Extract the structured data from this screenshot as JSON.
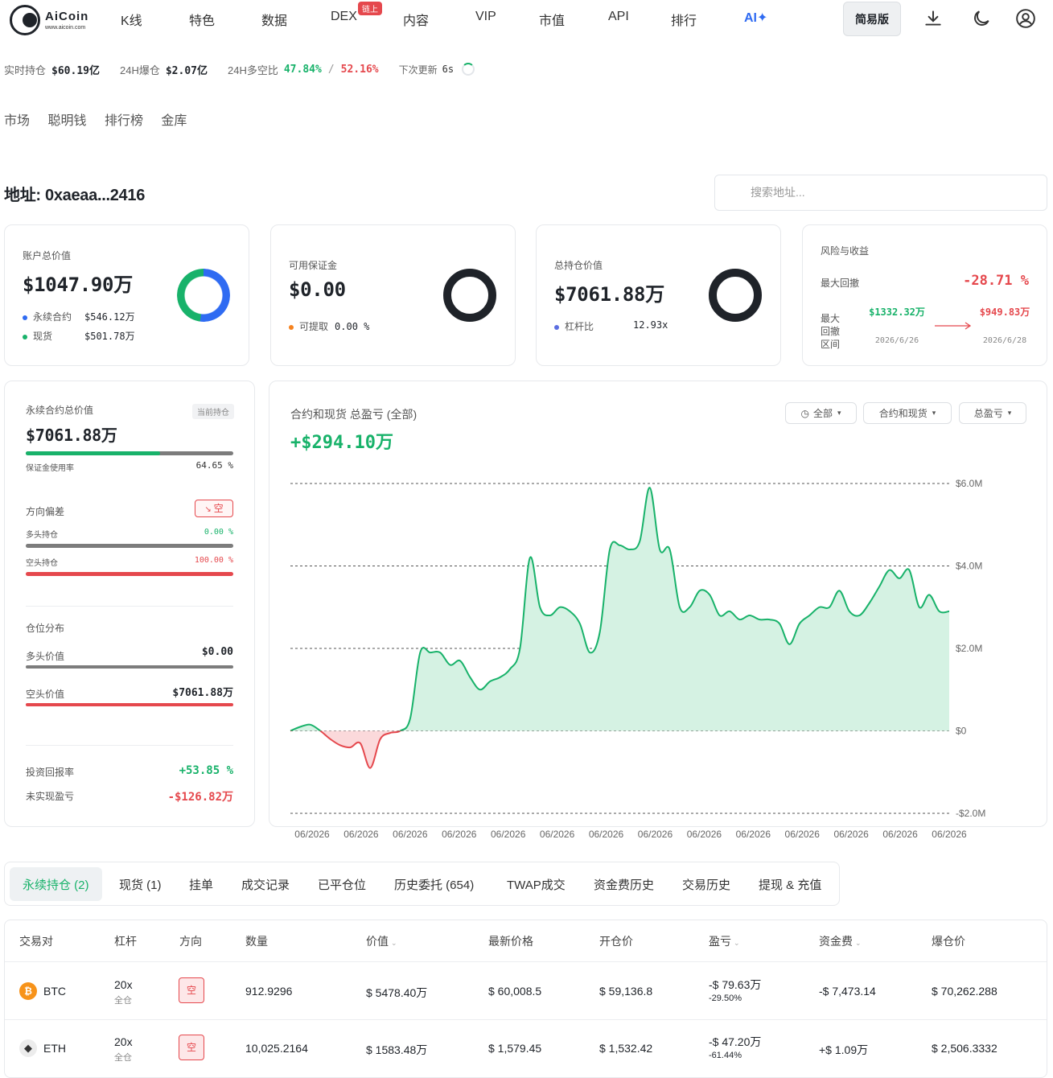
{
  "nav": {
    "logo_name": "AiCoin",
    "logo_sub": "www.aicoin.com",
    "items": [
      "K线",
      "特色",
      "数据",
      "DEX",
      "内容",
      "VIP",
      "市值",
      "API",
      "排行",
      "AI✦"
    ],
    "dex_badge": "链上",
    "simple_btn": "简易版",
    "icons": [
      "download-icon",
      "moon-icon",
      "user-icon"
    ]
  },
  "stats": {
    "holdings_label": "实时持仓",
    "holdings_value": "$60.19亿",
    "liq_label": "24H爆仓",
    "liq_value": "$2.07亿",
    "ratio_label": "24H多空比",
    "ratio_long": "47.84%",
    "ratio_sep": "/",
    "ratio_short": "52.16%",
    "next_label": "下次更新",
    "next_value": "6s"
  },
  "subnav": [
    "市场",
    "聪明钱",
    "排行榜",
    "金库"
  ],
  "address": {
    "title": "地址: 0xaeaa...2416",
    "search_placeholder": "搜索地址..."
  },
  "cards": {
    "account": {
      "label": "账户总价值",
      "value": "$1047.90万",
      "rows": [
        {
          "label": "永续合约",
          "value": "$546.12万",
          "color": "#2f6bf2"
        },
        {
          "label": "现货",
          "value": "$501.78万",
          "color": "#18b26a"
        }
      ],
      "ring": {
        "perp_fraction": 0.521,
        "spot_fraction": 0.479
      }
    },
    "margin": {
      "label": "可用保证金",
      "value": "$0.00",
      "row_label": "可提取",
      "row_value": "0.00 %",
      "color": "#f5821f"
    },
    "position": {
      "label": "总持仓价值",
      "value": "$7061.88万",
      "row_label": "杠杆比",
      "row_value": "12.93x",
      "color": "#5b6ee1"
    },
    "risk": {
      "label": "风险与收益",
      "dd_label": "最大回撤",
      "dd_value": "-28.71 %",
      "range_label": "最大回撤区间",
      "from_value": "$1332.32万",
      "from_date": "2026/6/26",
      "to_value": "$949.83万",
      "to_date": "2026/6/28"
    }
  },
  "perp": {
    "title": "永续合约总价值",
    "tag": "当前持仓",
    "value": "$7061.88万",
    "margin_label": "保证金使用率",
    "margin_value": "64.65 %",
    "margin_fraction": 0.6465,
    "bias_label": "方向偏差",
    "bias_tag": "空",
    "long_label": "多头持仓",
    "long_value": "0.00 %",
    "short_label": "空头持仓",
    "short_value": "100.00 %",
    "dist_label": "仓位分布",
    "long_val_label": "多头价值",
    "long_val": "$0.00",
    "short_val_label": "空头价值",
    "short_val": "$7061.88万",
    "roi_label": "投资回报率",
    "roi_value": "+53.85 %",
    "upnl_label": "未实现盈亏",
    "upnl_value": "-$126.82万"
  },
  "chart_title": "合约和现货 总盈亏 (全部)",
  "chart_value": "+$294.10万",
  "chart_buttons": [
    "全部",
    "合约和现货",
    "总盈亏"
  ],
  "chart_data": {
    "type": "area",
    "ylim": [
      -2.0,
      6.0
    ],
    "yticks": [
      6.0,
      4.0,
      2.0,
      0,
      -2.0
    ],
    "ytick_labels": [
      "$6.0M",
      "$4.0M",
      "$2.0M",
      "$0",
      "-$2.0M"
    ],
    "xtick_labels": [
      "06/2026",
      "06/2026",
      "06/2026",
      "06/2026",
      "06/2026",
      "06/2026",
      "06/2026",
      "06/2026",
      "06/2026",
      "06/2026",
      "06/2026",
      "06/2026",
      "06/2026",
      "06/2026"
    ],
    "grid": true,
    "series": [
      {
        "values": [
          0,
          0.1,
          0.15,
          0,
          -0.2,
          -0.35,
          -0.4,
          -0.3,
          -0.9,
          -0.2,
          -0.05,
          0,
          0.3,
          1.9,
          1.9,
          1.9,
          1.6,
          1.7,
          1.3,
          1.0,
          1.2,
          1.3,
          1.5,
          2.0,
          4.2,
          3.0,
          2.8,
          3.0,
          2.9,
          2.6,
          1.9,
          2.4,
          4.4,
          4.5,
          4.4,
          4.6,
          5.9,
          4.4,
          4.4,
          3.0,
          3.0,
          3.4,
          3.3,
          2.8,
          2.9,
          2.7,
          2.8,
          2.7,
          2.7,
          2.6,
          2.1,
          2.6,
          2.8,
          3.0,
          3.0,
          3.4,
          2.9,
          2.8,
          3.1,
          3.5,
          3.9,
          3.7,
          3.9,
          3.0,
          3.3,
          2.9,
          2.9
        ]
      }
    ]
  },
  "tabs": [
    "永续持仓 (2)",
    "现货 (1)",
    "挂单",
    "成交记录",
    "已平仓位",
    "历史委托 (654)",
    "TWAP成交",
    "资金费历史",
    "交易历史",
    "提现 & 充值"
  ],
  "table": {
    "headers": [
      "交易对",
      "杠杆",
      "方向",
      "数量",
      "价值",
      "最新价格",
      "开仓价",
      "盈亏",
      "资金费",
      "爆仓价"
    ],
    "rows": [
      {
        "pair": "BTC",
        "lev": "20x",
        "mode": "全仓",
        "dir": "空",
        "qty": "912.9296",
        "value": "$ 5478.40万",
        "last": "$ 60,008.5",
        "entry": "$ 59,136.8",
        "pnl": "-$ 79.63万",
        "pnl_pct": "-29.50%",
        "fund": "-$ 7,473.14",
        "liq": "$ 70,262.288",
        "coin_color": "#f7931a"
      },
      {
        "pair": "ETH",
        "lev": "20x",
        "mode": "全仓",
        "dir": "空",
        "qty": "10,025.2164",
        "value": "$ 1583.48万",
        "last": "$ 1,579.45",
        "entry": "$ 1,532.42",
        "pnl": "-$ 47.20万",
        "pnl_pct": "-61.44%",
        "fund": "+$ 1.09万",
        "liq": "$ 2,506.3332",
        "coin_color": "#627eea"
      }
    ]
  }
}
